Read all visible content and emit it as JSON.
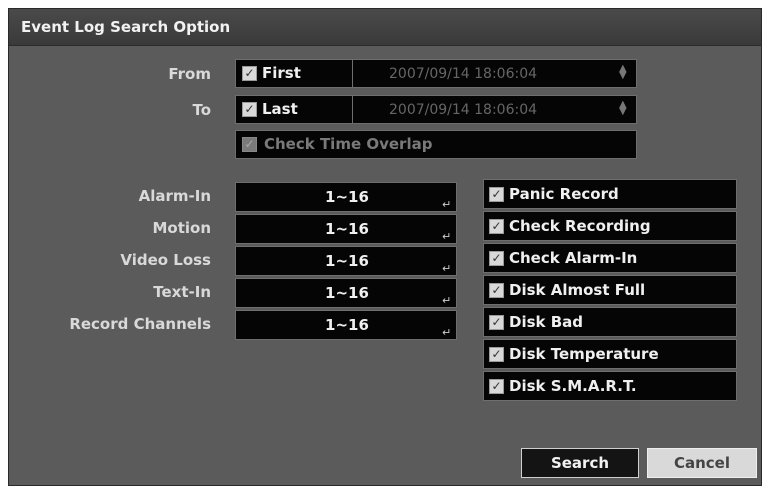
{
  "title": "Event Log Search Option",
  "from": {
    "label": "From",
    "checkbox_label": "First",
    "checked": true,
    "datetime": "2007/09/14  18:06:04"
  },
  "to": {
    "label": "To",
    "checkbox_label": "Last",
    "checked": true,
    "datetime": "2007/09/14  18:06:04"
  },
  "check_time_overlap": {
    "label": "Check Time Overlap",
    "checked": true,
    "disabled": true
  },
  "channel_rows": [
    {
      "label": "Alarm-In",
      "value": "1~16"
    },
    {
      "label": "Motion",
      "value": "1~16"
    },
    {
      "label": "Video Loss",
      "value": "1~16"
    },
    {
      "label": "Text-In",
      "value": "1~16"
    },
    {
      "label": "Record Channels",
      "value": "1~16"
    }
  ],
  "event_options": [
    {
      "label": "Panic Record",
      "checked": true
    },
    {
      "label": "Check Recording",
      "checked": true
    },
    {
      "label": "Check Alarm-In",
      "checked": true
    },
    {
      "label": "Disk Almost Full",
      "checked": true
    },
    {
      "label": "Disk Bad",
      "checked": true
    },
    {
      "label": "Disk Temperature",
      "checked": true
    },
    {
      "label": "Disk S.M.A.R.T.",
      "checked": true
    }
  ],
  "buttons": {
    "search": "Search",
    "cancel": "Cancel"
  },
  "icons": {
    "check": "check-icon",
    "spinner": "spinner-icon",
    "enter": "enter-icon"
  },
  "colors": {
    "dialog_bg": "#5b5b5b",
    "field_bg": "#050505",
    "title_bar": "#3f3f3f"
  }
}
